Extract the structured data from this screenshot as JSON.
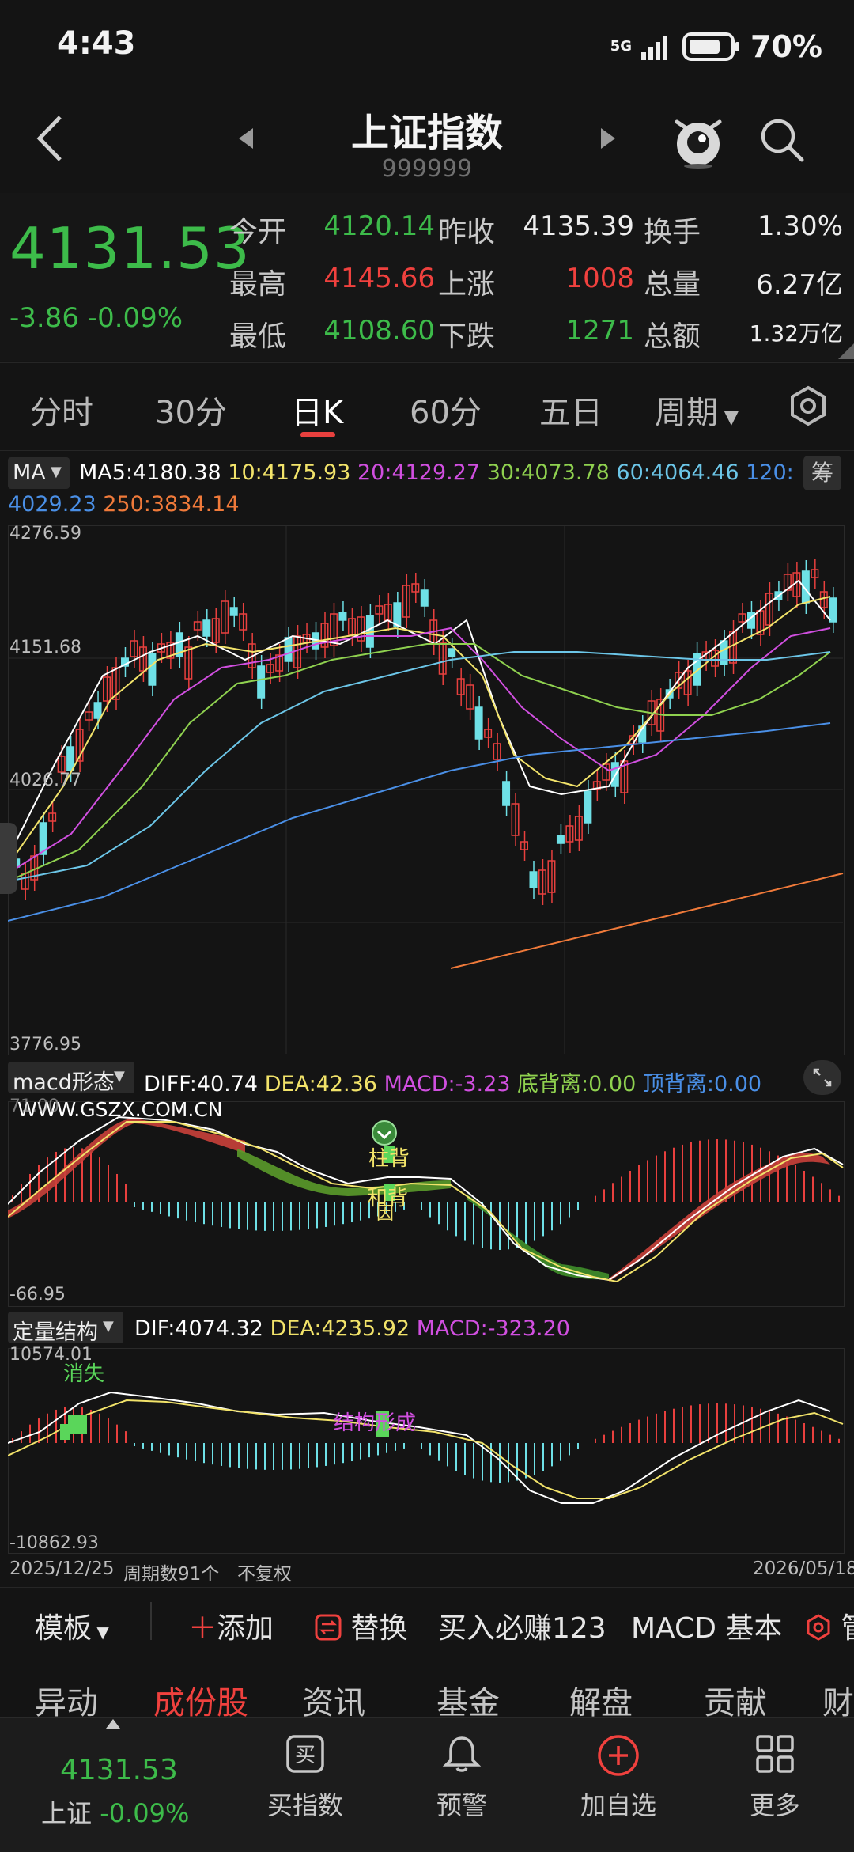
{
  "status_bar": {
    "time": "4:43",
    "network": "5G",
    "battery": "70%"
  },
  "header": {
    "title": "上证指数",
    "code": "999999"
  },
  "quote": {
    "last": "4131.53",
    "change": "-3.86",
    "change_pct": "-0.09%",
    "rows": [
      {
        "l1": "今开",
        "v1": "4120.14",
        "l2": "昨收",
        "v2": "4135.39",
        "l3": "换手",
        "v3": "1.30%"
      },
      {
        "l1": "最高",
        "v1": "4145.66",
        "l2": "上涨",
        "v2": "1008",
        "l3": "总量",
        "v3": "6.27亿"
      },
      {
        "l1": "最低",
        "v1": "4108.60",
        "l2": "下跌",
        "v2": "1271",
        "l3": "总额",
        "v3": "1.32万亿"
      }
    ]
  },
  "period_tabs": [
    "分时",
    "30分",
    "日K",
    "60分",
    "五日",
    "周期"
  ],
  "active_tab": "日K",
  "ma": {
    "selector": "MA",
    "ma5": "MA5:4180.38",
    "ma10": "10:4175.93",
    "ma20": "20:4129.27",
    "ma30": "30:4073.78",
    "ma60": "60:4064.46",
    "ma120": "120:",
    "ma120_val": "4029.23",
    "ma250": "250:3834.14",
    "chip_btn": "筹",
    "colors": {
      "ma5": "#ffffff",
      "ma10": "#f2e36a",
      "ma20": "#d14fe0",
      "ma30": "#8fd14f",
      "ma60": "#6cc6e8",
      "ma120": "#4a8fe6",
      "ma250": "#f07a3a"
    }
  },
  "kline": {
    "y_top": "4276.59",
    "y_mid": "4151.68",
    "y_low": "4026.77",
    "y_bottom": "3776.95"
  },
  "macd": {
    "selector": "macd形态",
    "diff": "DIFF:40.74",
    "dea": "DEA:42.36",
    "macd": "MACD:-3.23",
    "bottom_div": "底背离:0.00",
    "top_div": "顶背离:0.00",
    "watermark": "WWW.GSZX.COM.CN",
    "y_top": "71.00",
    "y_bottom": "-66.95",
    "label1": "柱背",
    "label2": "和背",
    "label3": "因"
  },
  "dl": {
    "selector": "定量结构",
    "dif": "DIF:4074.32",
    "dea": "DEA:4235.92",
    "macd": "MACD:-323.20",
    "y_top": "10574.01",
    "y_bottom": "-10862.93",
    "label_vanish": "消失",
    "label_form": "结构形成"
  },
  "time_axis": {
    "start": "2025/12/25",
    "period_count": "周期数91个",
    "adjust": "不复权",
    "end": "2026/05/18"
  },
  "toolbar": {
    "template": "模板",
    "add": "添加",
    "replace": "替换",
    "promo": "买入必赚123",
    "macd_basic": "MACD 基本",
    "manage": "管"
  },
  "sub_tabs": [
    "异动",
    "成份股",
    "资讯",
    "基金",
    "解盘",
    "贡献",
    "财"
  ],
  "sub_active": "成份股",
  "bottom_nav": {
    "index_price": "4131.53",
    "index_name": "上证",
    "index_change": "-0.09%",
    "items": [
      {
        "label": "买指数",
        "icon": "buy-icon"
      },
      {
        "label": "预警",
        "icon": "bell-icon"
      },
      {
        "label": "加自选",
        "icon": "plus-circle-icon"
      },
      {
        "label": "更多",
        "icon": "grid-icon"
      }
    ],
    "buy_glyph": "买"
  }
}
